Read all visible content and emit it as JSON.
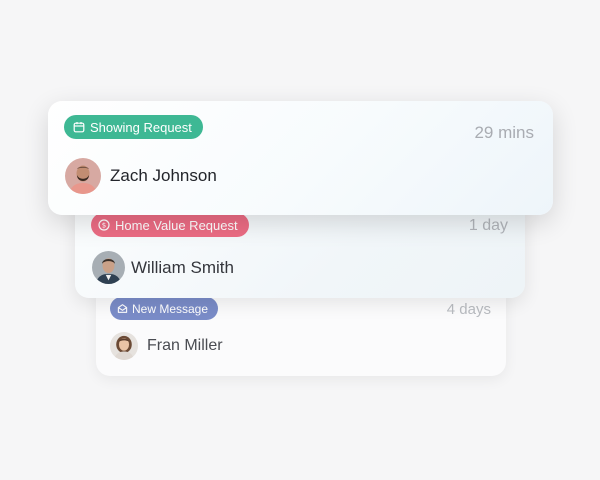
{
  "notifications": [
    {
      "badge": "Showing Request",
      "badge_icon": "calendar-icon",
      "badge_color": "#3eb894",
      "time": "29 mins",
      "person": "Zach Johnson",
      "avatar_bg": "#d7a9a2"
    },
    {
      "badge": "Home Value Request",
      "badge_icon": "dollar-circle-icon",
      "badge_color": "#ec6c84",
      "time": "1 day",
      "person": "William Smith",
      "avatar_bg": "#a7aeb4"
    },
    {
      "badge": "New Message",
      "badge_icon": "envelope-icon",
      "badge_color": "#7a8cc8",
      "time": "4 days",
      "person": "Fran Miller",
      "avatar_bg": "#e6e2de"
    }
  ]
}
